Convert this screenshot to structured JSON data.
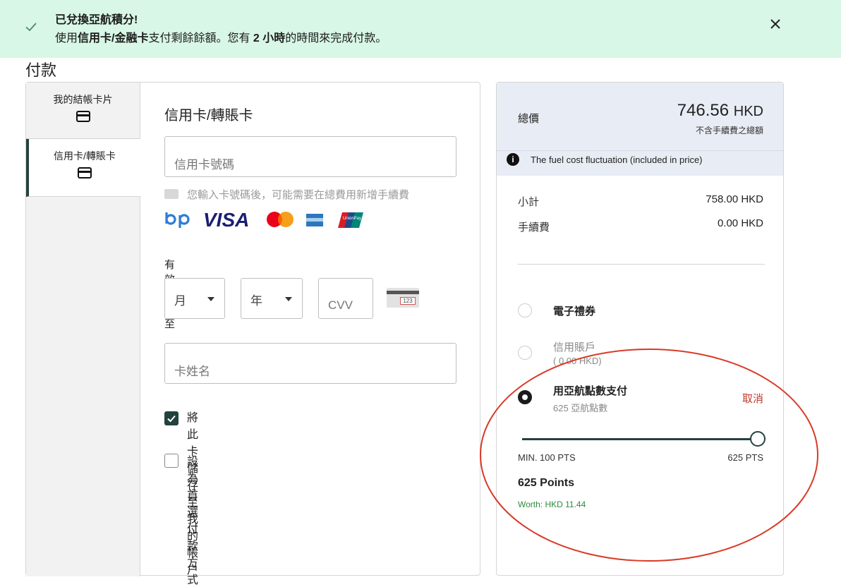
{
  "banner": {
    "title": "已兌換亞航積分!",
    "msg_prefix": "使用",
    "msg_bold1": "信用卡/金融卡",
    "msg_mid": "支付剩餘餘額。您有 ",
    "msg_bold2": "2 小時",
    "msg_suffix": "的時間來完成付款。",
    "bg_color": "#d8f7e6"
  },
  "page": {
    "title": "付款"
  },
  "tabs": [
    {
      "label": "我的結帳卡片",
      "icon": "card-icon"
    },
    {
      "label": "信用卡/轉賬卡",
      "icon": "card-icon"
    }
  ],
  "form": {
    "title": "信用卡/轉賬卡",
    "card_number_placeholder": "信用卡號碼",
    "hint": "您輸入卡號碼後，可能需要在總費用新增手續費",
    "logos": [
      "bp-logo",
      "VISA",
      "mastercard-logo",
      "amex-logo",
      "unionpay-logo"
    ],
    "visa_text": "VISA",
    "unionpay_text": "UnionPay",
    "expiry_label": "有效日期至",
    "month_value": "月",
    "year_value": "年",
    "cvv_placeholder": "CVV",
    "cvv_card_digits": "123",
    "name_placeholder": "卡姓名",
    "save_card_label": "將此卡儲存至我的帳户",
    "save_card_checked": true,
    "preferred_label": "設為首選付款方式",
    "preferred_checked": false
  },
  "summary": {
    "total_label": "總價",
    "total_amount": "746.56",
    "total_currency": "HKD",
    "total_note": "不含手續費之總額",
    "info_text": "The fuel cost fluctuation (included in price)",
    "subtotal_label": "小計",
    "subtotal_value": "758.00 HKD",
    "fee_label": "手續費",
    "fee_value": "0.00 HKD",
    "options": [
      {
        "title": "電子禮券",
        "sub": "",
        "selected": false
      },
      {
        "title": "信用賬戶",
        "sub": "( 0.00 HKD)",
        "selected": false
      },
      {
        "title": "用亞航點數支付",
        "sub": "625 亞航點數",
        "selected": true
      }
    ],
    "cancel_label": "取消",
    "slider_min_label": "MIN. 100 PTS",
    "slider_max_label": "625 PTS",
    "slider_value": 625,
    "slider_min": 100,
    "slider_max": 625,
    "points_text": "625 Points",
    "worth_text": "Worth: HKD 11.44"
  },
  "colors": {
    "accent": "#23413f",
    "annotation": "#d93a26",
    "cancel": "#c0392b",
    "worth": "#2e8b3d"
  }
}
